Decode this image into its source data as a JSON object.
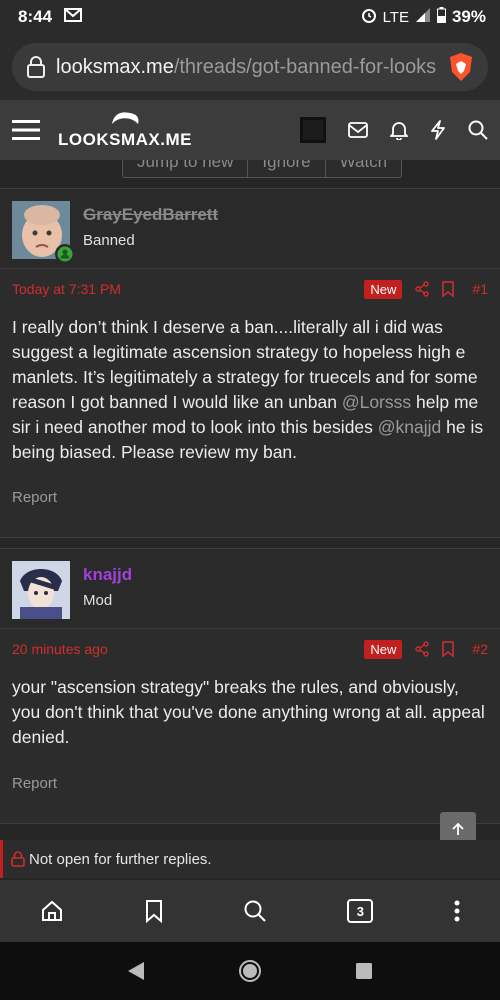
{
  "status": {
    "time": "8:44",
    "network": "LTE",
    "battery": "39%"
  },
  "browser": {
    "url_host": "looksmax.me",
    "url_path": "/threads/got-banned-for-looks",
    "tabs_count": "3"
  },
  "site": {
    "logo_text": "LOOKSMAX.ME"
  },
  "jump": {
    "items": [
      "Jump to new",
      "Ignore",
      "Watch"
    ]
  },
  "posts": [
    {
      "username": "GrayEyedBarrett",
      "title": "Banned",
      "time": "Today at 7:31 PM",
      "badge": "New",
      "number": "#1",
      "body_1": "I really don’t think I deserve a ban....literally all i did was suggest a legitimate ascension strategy to hopeless high e manlets. It’s legitimately a strategy for truecels and for some reason I got banned I would like an unban ",
      "mention_1": "@Lorsss",
      "body_2": " help me sir i need another mod to look into this besides ",
      "mention_2": "@knajjd",
      "body_3": " he is being biased. Please review my ban.",
      "report": "Report"
    },
    {
      "username": "knajjd",
      "title": "Mod",
      "time": "20 minutes ago",
      "badge": "New",
      "number": "#2",
      "body": "your \"ascension strategy\" breaks the rules, and obviously, you don't think that you've done anything wrong at all. appeal denied.",
      "report": "Report"
    }
  ],
  "thread": {
    "closed_text": "Not open for further replies."
  },
  "colors": {
    "accent_red": "#d42c2c",
    "mod_purple": "#a040d8",
    "bg": "#262626"
  }
}
